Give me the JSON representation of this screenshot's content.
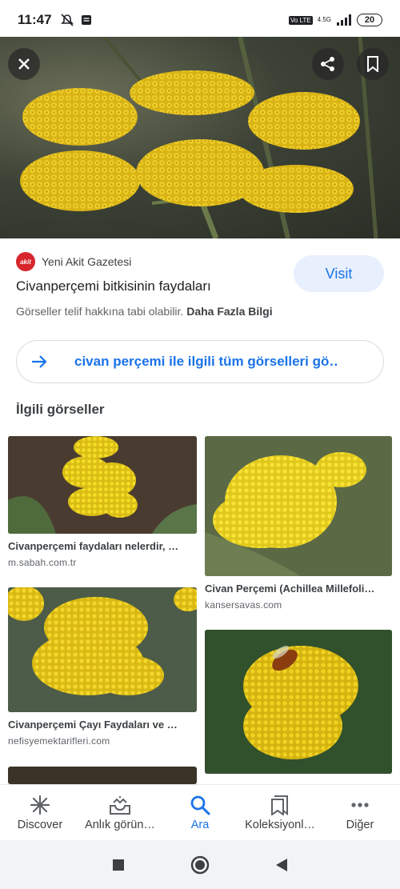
{
  "status_bar": {
    "time": "11:47",
    "volte": "Vo LTE",
    "network": "4.5G",
    "battery": "20"
  },
  "hero": {
    "close_icon": "close-icon",
    "share_icon": "share-icon",
    "bookmark_icon": "bookmark-icon"
  },
  "result": {
    "source_logo": "akit",
    "source_name": "Yeni Akit Gazetesi",
    "title": "Civanperçemi bitkisinin faydaları",
    "visit_label": "Visit",
    "copyright_text": "Görseller telif hakkına tabi olabilir.",
    "more_info": "Daha Fazla Bilgi"
  },
  "all_images": {
    "label": "civan perçemi ile ilgili tüm görselleri gö…"
  },
  "related": {
    "heading": "İlgili görseller",
    "items": [
      {
        "title": "Civanperçemi faydaları nelerdir, …",
        "domain": "m.sabah.com.tr"
      },
      {
        "title": "Civan Perçemi (Achillea Millefoli…",
        "domain": "kansersavas.com"
      },
      {
        "title": "Civanperçemi Çayı Faydaları ve …",
        "domain": "nefisyemektarifleri.com"
      },
      {
        "title": "",
        "domain": ""
      }
    ]
  },
  "bottom_nav": {
    "items": [
      {
        "label": "Discover",
        "icon": "asterisk-icon"
      },
      {
        "label": "Anlık görün…",
        "icon": "inbox-tray-icon"
      },
      {
        "label": "Ara",
        "icon": "search-icon"
      },
      {
        "label": "Koleksiyonl…",
        "icon": "collections-icon"
      },
      {
        "label": "Diğer",
        "icon": "more-dots-icon"
      }
    ],
    "active_index": 2
  },
  "colors": {
    "accent": "#1a73e8",
    "flower_yellow": "#e8c21a",
    "visit_bg": "#e8f0fe"
  }
}
